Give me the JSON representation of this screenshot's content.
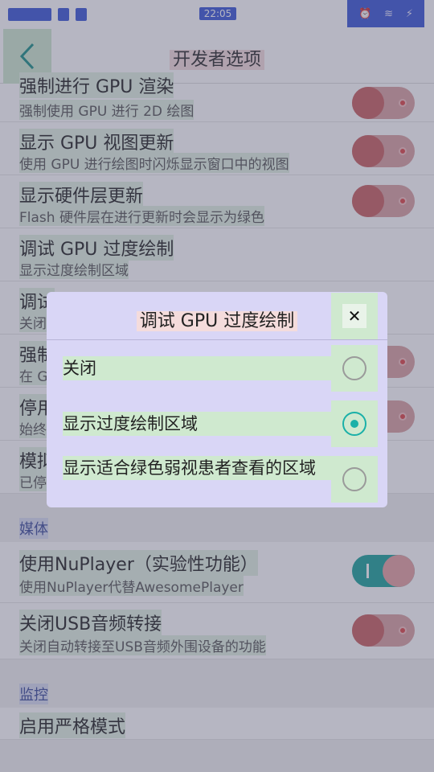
{
  "status_bar": {
    "time": "22:05",
    "icons": [
      "signal-icon",
      "sim-icon",
      "alarm-icon",
      "wifi-icon",
      "battery-charging-icon"
    ]
  },
  "header": {
    "title": "开发者选项",
    "back_icon": "chevron-left-icon"
  },
  "settings": [
    {
      "title": "强制进行 GPU 渲染",
      "subtitle": "强制使用 GPU 进行 2D 绘图",
      "toggle": "off",
      "cut": true
    },
    {
      "title": "显示 GPU 视图更新",
      "subtitle": "使用 GPU 进行绘图时闪烁显示窗口中的视图",
      "toggle": "off"
    },
    {
      "title": "显示硬件层更新",
      "subtitle": "Flash 硬件层在进行更新时会显示为绿色",
      "toggle": "off"
    },
    {
      "title": "调试 GPU 过度绘制",
      "subtitle": "显示过度绘制区域"
    },
    {
      "title": "调试",
      "subtitle": "关闭"
    },
    {
      "title": "强制",
      "subtitle": "在 G",
      "toggle": "off"
    },
    {
      "title": "停用",
      "subtitle": "始终",
      "toggle": "off"
    },
    {
      "title": "模拟",
      "subtitle": "已停用"
    }
  ],
  "media_section": {
    "label": "媒体",
    "items": [
      {
        "title": "使用NuPlayer（实验性功能）",
        "subtitle": "使用NuPlayer代替AwesomePlayer",
        "toggle": "on"
      },
      {
        "title": "关闭USB音频转接",
        "subtitle": "关闭自动转接至USB音频外围设备的功能",
        "toggle": "off"
      }
    ]
  },
  "monitor_section": {
    "label": "监控",
    "partial_item": "启用严格模式"
  },
  "dialog": {
    "title": "调试 GPU 过度绘制",
    "close_symbol": "✕",
    "options": [
      {
        "label": "关闭",
        "selected": false
      },
      {
        "label": "显示过度绘制区域",
        "selected": true
      },
      {
        "label": "显示适合绿色弱视患者查看的区域",
        "selected": false
      }
    ]
  },
  "colors": {
    "accent": "#1ab0a8",
    "toggle_off": "#d9a0a0",
    "toggle_on": "#1aa39a"
  }
}
